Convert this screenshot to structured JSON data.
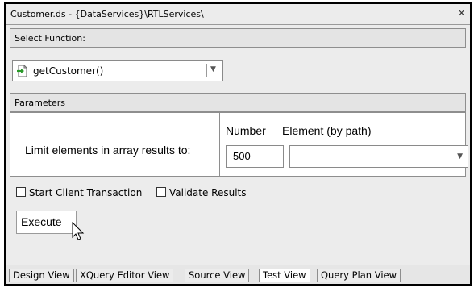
{
  "window": {
    "title": "Customer.ds - {DataServices}\\RTLServices\\",
    "close_glyph": "×"
  },
  "select_function": {
    "header": "Select Function:",
    "selected": "getCustomer()"
  },
  "parameters": {
    "header": "Parameters",
    "limit_label": "Limit elements in array results to:",
    "number_label": "Number",
    "number_value": "500",
    "element_label": "Element (by path)",
    "element_value": ""
  },
  "options": {
    "start_client_transaction": {
      "label": "Start Client Transaction",
      "checked": false
    },
    "validate_results": {
      "label": "Validate Results",
      "checked": false
    }
  },
  "execute_label": "Execute",
  "tabs": [
    {
      "label": "Design View",
      "active": false
    },
    {
      "label": "XQuery Editor View",
      "active": false
    },
    {
      "label": "Source View",
      "active": false
    },
    {
      "label": "Test View",
      "active": true
    },
    {
      "label": "Query Plan View",
      "active": false
    }
  ],
  "colors": {
    "function_icon_green": "#2a9a2a"
  }
}
